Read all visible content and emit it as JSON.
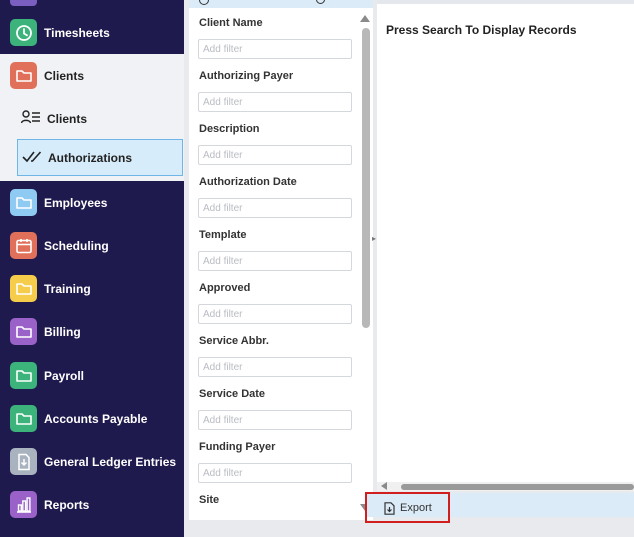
{
  "sidebar": {
    "items": [
      {
        "label": "Timesheets",
        "icon": "clock-icon",
        "color": "#3bb37a"
      },
      {
        "label": "Clients",
        "icon": "folder-icon",
        "color": "#e0705a"
      },
      {
        "label": "Employees",
        "icon": "folder-icon",
        "color": "#8fcaf2"
      },
      {
        "label": "Scheduling",
        "icon": "calendar-icon",
        "color": "#e0705a"
      },
      {
        "label": "Training",
        "icon": "folder-icon",
        "color": "#f5cd4a"
      },
      {
        "label": "Billing",
        "icon": "folder-icon",
        "color": "#9a62c8"
      },
      {
        "label": "Payroll",
        "icon": "folder-icon",
        "color": "#3bb37a"
      },
      {
        "label": "Accounts Payable",
        "icon": "folder-icon",
        "color": "#3bb37a"
      },
      {
        "label": "General Ledger Entries",
        "icon": "download-doc-icon",
        "color": "#a9b3c0"
      },
      {
        "label": "Reports",
        "icon": "bar-chart-icon",
        "color": "#9a62c8"
      }
    ],
    "sub_items": [
      {
        "label": "Clients",
        "icon": "people-list-icon"
      },
      {
        "label": "Authorizations",
        "icon": "double-check-icon"
      }
    ]
  },
  "filters": {
    "fields": [
      {
        "label": "Client Name",
        "placeholder": "Add filter"
      },
      {
        "label": "Authorizing Payer",
        "placeholder": "Add filter"
      },
      {
        "label": "Description",
        "placeholder": "Add filter"
      },
      {
        "label": "Authorization Date",
        "placeholder": "Add filter"
      },
      {
        "label": "Template",
        "placeholder": "Add filter"
      },
      {
        "label": "Approved",
        "placeholder": "Add filter"
      },
      {
        "label": "Service Abbr.",
        "placeholder": "Add filter"
      },
      {
        "label": "Service Date",
        "placeholder": "Add filter"
      },
      {
        "label": "Funding Payer",
        "placeholder": "Add filter"
      },
      {
        "label": "Site",
        "placeholder": ""
      }
    ]
  },
  "results": {
    "message": "Press Search To Display Records"
  },
  "footer": {
    "export_label": "Export"
  },
  "colors": {
    "sidebar_bg": "#1f1a4d",
    "highlight_border": "#d11f1f",
    "selected_bg": "#d6ecfa"
  }
}
